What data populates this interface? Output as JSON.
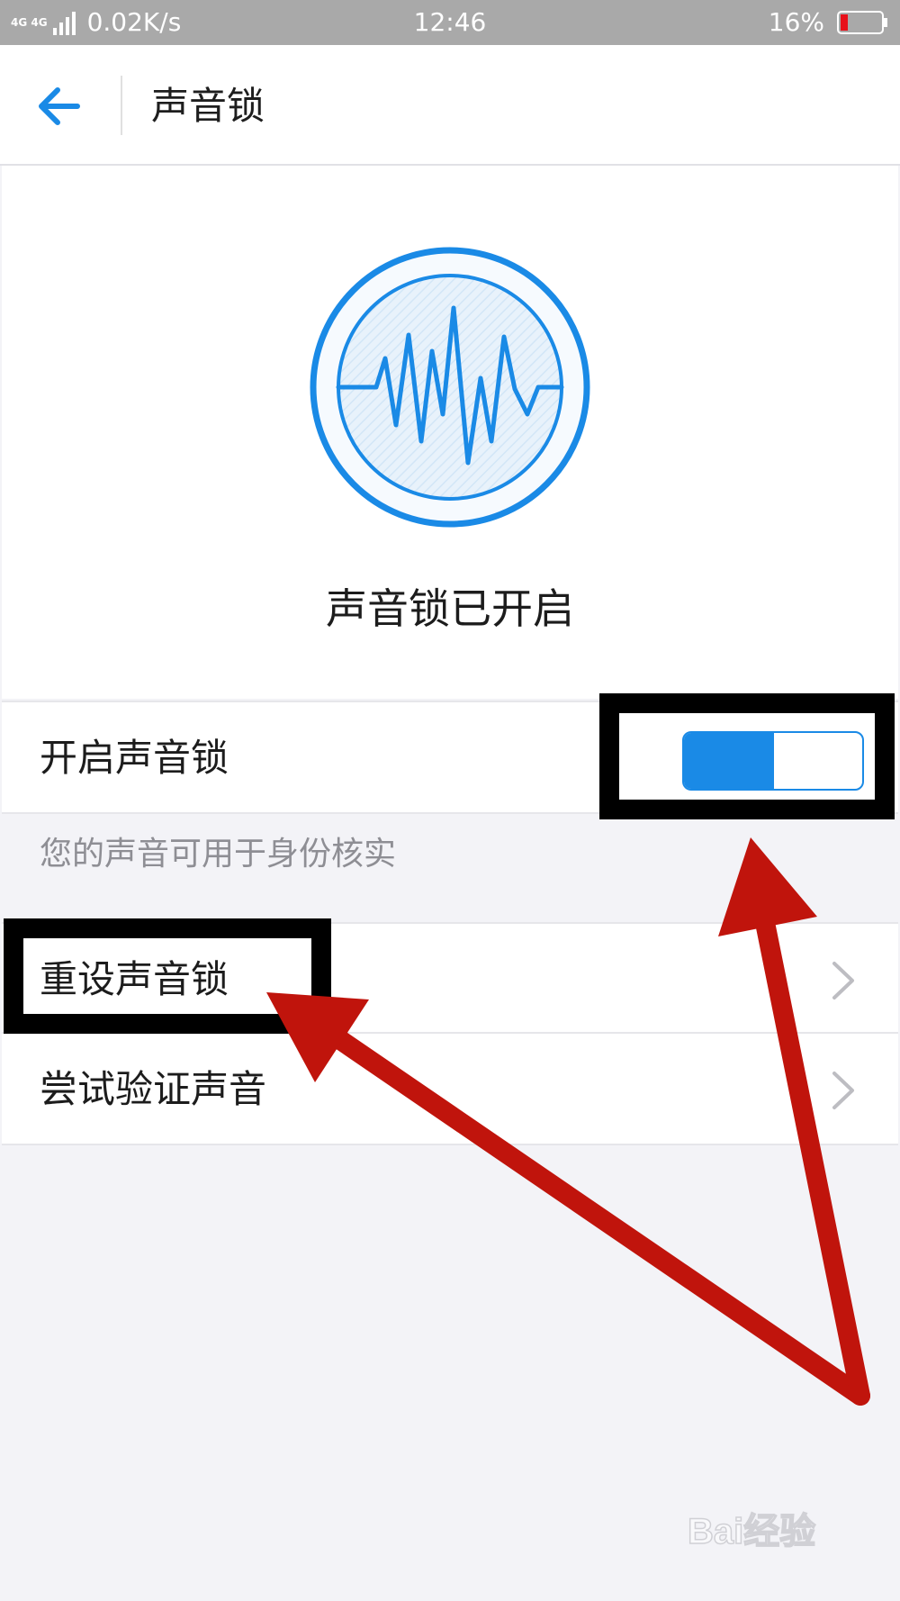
{
  "status_bar": {
    "network_type": "4G 4G",
    "net_speed": "0.02K/s",
    "time": "12:46",
    "battery_percent": "16%",
    "signal_icon": "signal-bars-icon",
    "battery_icon": "battery-low-icon"
  },
  "header": {
    "back_icon": "back-arrow-icon",
    "title": "声音锁"
  },
  "hero": {
    "emblem_icon": "sound-wave-icon",
    "status_text": "声音锁已开启"
  },
  "settings": {
    "toggle": {
      "label": "开启声音锁",
      "state": "on"
    },
    "helper_text": "您的声音可用于身份核实",
    "reset": {
      "label": "重设声音锁"
    },
    "verify": {
      "label": "尝试验证声音"
    }
  },
  "watermark": {
    "text": "Bai经验"
  },
  "colors": {
    "accent": "#1a8ae6",
    "annotation_arrow": "#c0140c",
    "annotation_box": "#000000",
    "background": "#f3f3f7"
  }
}
